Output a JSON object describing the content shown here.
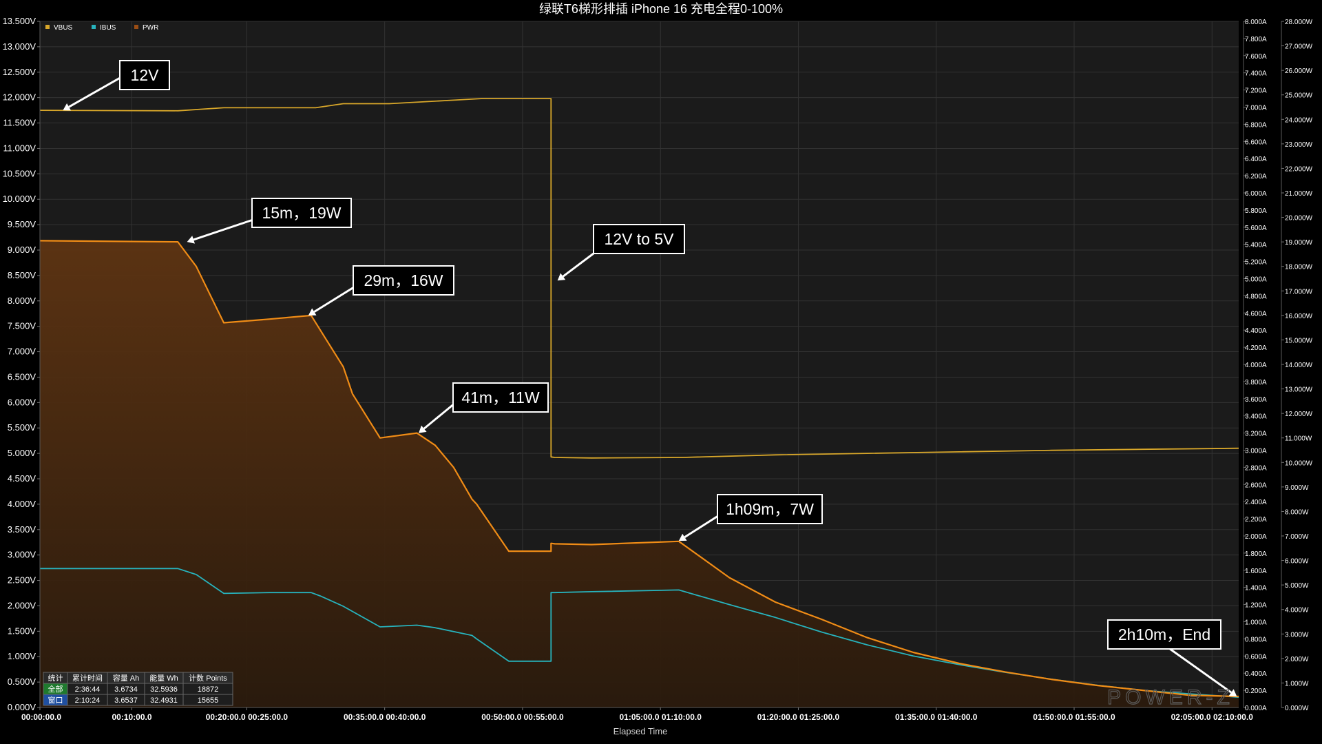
{
  "colors": {
    "background": "#1b1b1b",
    "grid": "#333333",
    "vbus": "#d8a72a",
    "ibus": "#27b3bd",
    "pwr": "#f08c16",
    "pwr_fill_top": "#5e3412",
    "pwr_fill_bottom": "#2a1a0c",
    "annotation_bg": "#000000",
    "annotation_border": "#ffffff",
    "text": "#ffffff",
    "table_row_all": "#1f7a2e",
    "table_row_window": "#1f4fa0"
  },
  "chart_data": {
    "type": "line",
    "title": "绿联T6梯形排插 iPhone 16 充电全程0-100%",
    "xlabel": "Elapsed Time",
    "x_unit": "minutes",
    "xlim": [
      0,
      130.4
    ],
    "legend_placement": "top-left",
    "grid": true,
    "legend": [
      "VBUS",
      "IBUS",
      "PWR"
    ],
    "x_ticks": [
      {
        "t": 0,
        "label": "00:00:00.0"
      },
      {
        "t": 10,
        "label": "00:10:00.0"
      },
      {
        "t": 22.5,
        "label": "00:20:00.0 00:25:00.0"
      },
      {
        "t": 37.5,
        "label": "00:35:00.0 00:40:00.0"
      },
      {
        "t": 52.5,
        "label": "00:50:00.0 00:55:00.0"
      },
      {
        "t": 67.5,
        "label": "01:05:00.0 01:10:00.0"
      },
      {
        "t": 82.5,
        "label": "01:20:00.0 01:25:00.0"
      },
      {
        "t": 97.5,
        "label": "01:35:00.0 01:40:00.0"
      },
      {
        "t": 112.5,
        "label": "01:50:00.0 01:55:00.0"
      },
      {
        "t": 127.5,
        "label": "02:05:00.0 02:10:00.0"
      }
    ],
    "axes": {
      "voltage": {
        "ylim": [
          0,
          13.5
        ],
        "step": 0.5,
        "ticks": [
          "0.000V",
          "0.500V",
          "1.000V",
          "1.500V",
          "2.000V",
          "2.500V",
          "3.000V",
          "3.500V",
          "4.000V",
          "4.500V",
          "5.000V",
          "5.500V",
          "6.000V",
          "6.500V",
          "7.000V",
          "7.500V",
          "8.000V",
          "8.500V",
          "9.000V",
          "9.500V",
          "10.000V",
          "10.500V",
          "11.000V",
          "11.500V",
          "12.000V",
          "12.500V",
          "13.000V",
          "13.500V"
        ]
      },
      "current": {
        "ylim": [
          0,
          8.0
        ],
        "step": 0.2,
        "ticks": [
          "0.000A",
          "0.200A",
          "0.400A",
          "0.600A",
          "0.800A",
          "1.000A",
          "1.200A",
          "1.400A",
          "1.600A",
          "1.800A",
          "2.000A",
          "2.200A",
          "2.400A",
          "2.600A",
          "2.800A",
          "3.000A",
          "3.200A",
          "3.400A",
          "3.600A",
          "3.800A",
          "4.000A",
          "4.200A",
          "4.400A",
          "4.600A",
          "4.800A",
          "5.000A",
          "5.200A",
          "5.400A",
          "5.600A",
          "5.800A",
          "6.000A",
          "6.200A",
          "6.400A",
          "6.600A",
          "6.800A",
          "7.000A",
          "7.200A",
          "7.400A",
          "7.600A",
          "7.800A",
          "8.000A"
        ]
      },
      "power": {
        "ylim": [
          0,
          28.0
        ],
        "step": 1.0,
        "ticks": [
          "0.000W",
          "1.000W",
          "2.000W",
          "3.000W",
          "4.000W",
          "5.000W",
          "6.000W",
          "7.000W",
          "8.000W",
          "9.000W",
          "10.000W",
          "11.000W",
          "12.000W",
          "13.000W",
          "14.000W",
          "15.000W",
          "16.000W",
          "17.000W",
          "18.000W",
          "19.000W",
          "20.000W",
          "21.000W",
          "22.000W",
          "23.000W",
          "24.000W",
          "25.000W",
          "26.000W",
          "27.000W",
          "28.000W"
        ]
      }
    },
    "series": [
      {
        "name": "VBUS",
        "axis": "voltage",
        "x": [
          0,
          15,
          20,
          30,
          33,
          38,
          45,
          48,
          55.6,
          55.6,
          56,
          60,
          70,
          80,
          90,
          100,
          110,
          120,
          130.4
        ],
        "y": [
          11.75,
          11.74,
          11.8,
          11.8,
          11.88,
          11.88,
          11.95,
          11.98,
          11.98,
          4.93,
          4.92,
          4.91,
          4.92,
          4.97,
          5.0,
          5.03,
          5.06,
          5.08,
          5.1
        ]
      },
      {
        "name": "IBUS",
        "axis": "current",
        "x": [
          0,
          15,
          17,
          20,
          25,
          29.5,
          30.5,
          33,
          37,
          41,
          43,
          47,
          47.5,
          51,
          55.6,
          55.6,
          56,
          60,
          69.5,
          75,
          80,
          85,
          90,
          95,
          100,
          105,
          110,
          115,
          120,
          125,
          130.4
        ],
        "y": [
          1.62,
          1.62,
          1.55,
          1.33,
          1.34,
          1.34,
          1.3,
          1.18,
          0.94,
          0.96,
          0.93,
          0.84,
          0.8,
          0.54,
          0.54,
          1.34,
          1.34,
          1.35,
          1.37,
          1.2,
          1.05,
          0.88,
          0.73,
          0.6,
          0.5,
          0.41,
          0.33,
          0.26,
          0.2,
          0.16,
          0.12
        ]
      },
      {
        "name": "PWR",
        "axis": "power",
        "x": [
          0,
          15,
          17,
          20,
          25,
          29.5,
          30.5,
          33,
          34,
          37,
          41,
          43,
          45,
          47,
          47.5,
          51,
          55.6,
          55.6,
          56,
          60,
          69.5,
          75,
          80,
          85,
          90,
          95,
          100,
          105,
          110,
          115,
          120,
          125,
          130.4
        ],
        "y": [
          19.05,
          19.0,
          18.0,
          15.7,
          15.85,
          16.0,
          15.4,
          13.9,
          12.8,
          11.0,
          11.2,
          10.7,
          9.8,
          8.5,
          8.3,
          6.38,
          6.38,
          6.7,
          6.68,
          6.65,
          6.78,
          5.3,
          4.3,
          3.6,
          2.85,
          2.25,
          1.8,
          1.45,
          1.15,
          0.9,
          0.7,
          0.5,
          0.45
        ]
      }
    ],
    "annotations": [
      {
        "label": "12V",
        "target_t": 2.5,
        "target_v": 11.75
      },
      {
        "label": "15m，19W",
        "target_t": 16.0,
        "target_w": 19.0
      },
      {
        "label": "29m，16W",
        "target_t": 29.2,
        "target_w": 16.0
      },
      {
        "label": "12V to 5V",
        "target_t": 56.3,
        "target_v": 8.4
      },
      {
        "label": "41m，11W",
        "target_t": 41.2,
        "target_w": 11.2
      },
      {
        "label": "1h09m，7W",
        "target_t": 69.5,
        "target_w": 6.8
      },
      {
        "label": "2h10m，End",
        "target_t": 130.2,
        "target_w": 0.45
      }
    ],
    "stats_table": {
      "headers": [
        "统计",
        "累计时间",
        "容量 Ah",
        "能量 Wh",
        "计数 Points"
      ],
      "rows": [
        {
          "label": "全部",
          "values": [
            "2:36:44",
            "3.6734",
            "32.5936",
            "18872"
          ]
        },
        {
          "label": "窗口",
          "values": [
            "2:10:24",
            "3.6537",
            "32.4931",
            "15655"
          ]
        }
      ]
    }
  }
}
